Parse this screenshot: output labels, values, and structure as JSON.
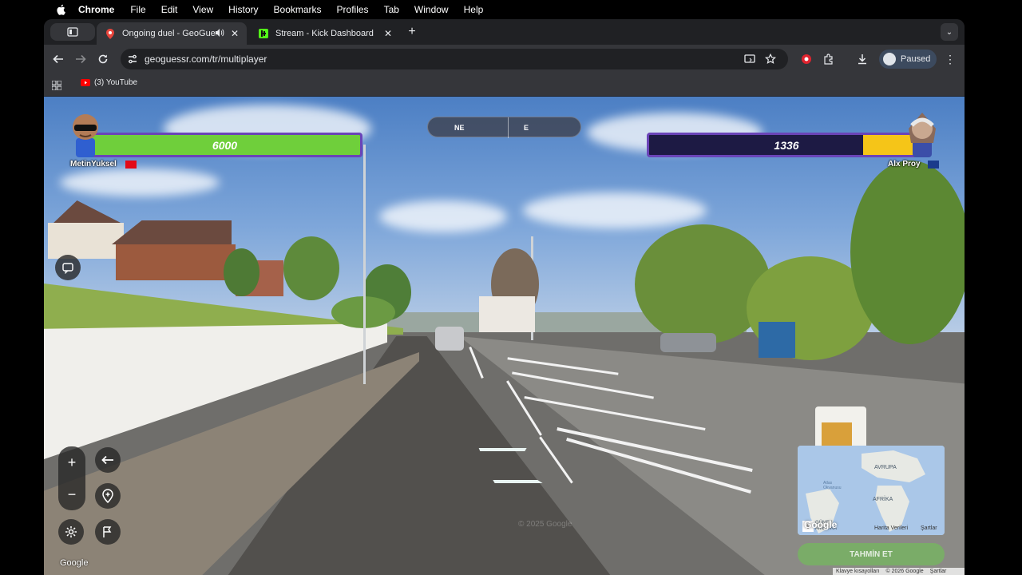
{
  "menubar": {
    "app": "Chrome",
    "items": [
      "File",
      "Edit",
      "View",
      "History",
      "Bookmarks",
      "Profiles",
      "Tab",
      "Window",
      "Help"
    ]
  },
  "tabs": [
    {
      "title": "Ongoing duel - GeoGuessr",
      "active": true
    },
    {
      "title": "Stream - Kick Dashboard",
      "active": false
    }
  ],
  "toolbar": {
    "url": "geoguessr.com/tr/multiplayer",
    "profile_label": "Paused"
  },
  "bookmarks": [
    {
      "label": "(3) YouTube"
    }
  ],
  "game": {
    "player_left": {
      "name": "MetinYuksel",
      "health": "6000",
      "health_fraction": 1.0,
      "color": "#6fcf3b"
    },
    "player_right": {
      "name": "Alx Proy",
      "health": "1336",
      "health_fraction": 0.22,
      "color": "#f5c518"
    },
    "compass": {
      "labels": [
        "NE",
        "E"
      ]
    },
    "map": {
      "labels": [
        "AVRUPA",
        "AFRİKA",
        "GÜNEY AMERİKA",
        "Atlas Okyanusu"
      ],
      "attribution": "Google",
      "data_label": "Harita Verileri",
      "terms": "Şartlar"
    },
    "guess_button": "TAHMİN ET",
    "copyright_overlay": "© 2025 Google",
    "google_logo": "Google",
    "footer": [
      "Klavye kısayolları",
      "© 2026 Google",
      "Şartlar"
    ]
  }
}
